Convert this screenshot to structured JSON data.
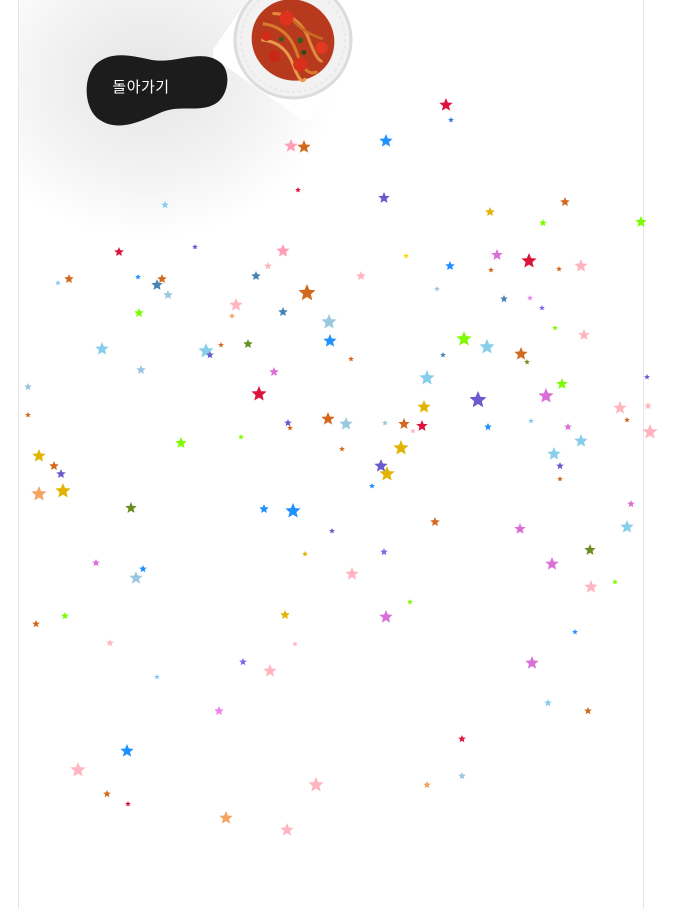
{
  "back_button": {
    "label": "돌아가기"
  },
  "dish_image": {
    "icon": "spaghetti-plate-icon"
  },
  "confetti": {
    "icon": "star-icon",
    "colors": [
      "#e0b400",
      "#ffd700",
      "#1e90ff",
      "#2e7fd8",
      "#6a5acd",
      "#7b68ee",
      "#dc143c",
      "#d2691e",
      "#f4a460",
      "#ffb6c1",
      "#ff9eb5",
      "#87ceeb",
      "#9ac8e0",
      "#ee82ee",
      "#da70d6",
      "#6b8e23",
      "#556b2f",
      "#7cfc00",
      "#90ee90",
      "#4682b4"
    ]
  }
}
